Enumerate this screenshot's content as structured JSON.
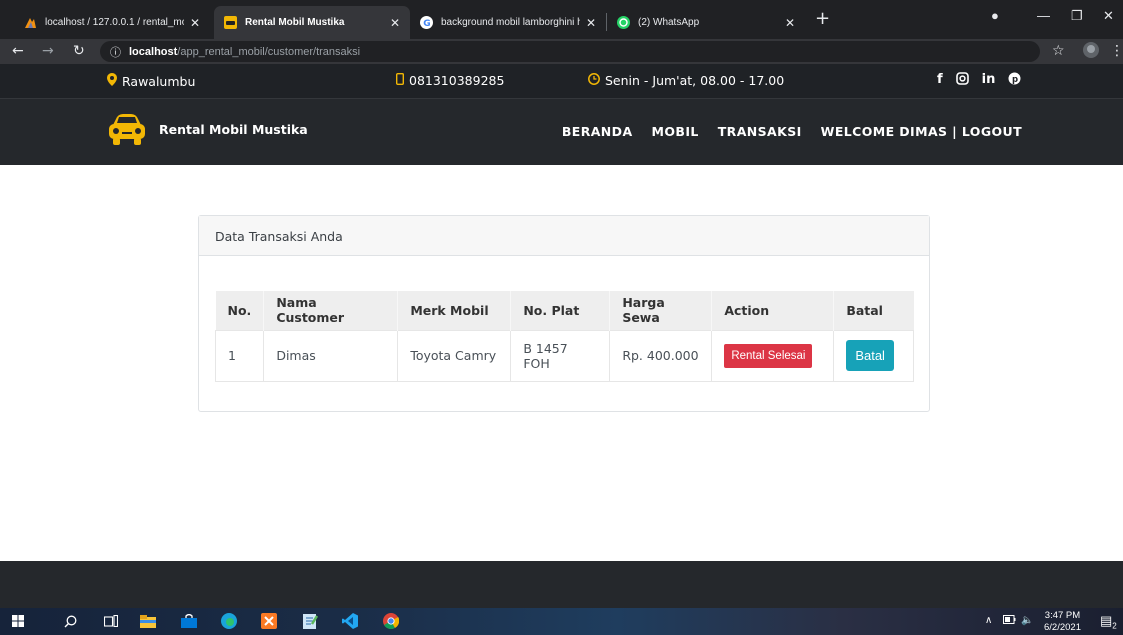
{
  "browser": {
    "tabs": [
      {
        "title": "localhost / 127.0.0.1 / rental_mob"
      },
      {
        "title": "Rental Mobil Mustika"
      },
      {
        "title": "background mobil lamborghini h"
      },
      {
        "title": "(2) WhatsApp"
      }
    ],
    "url_host": "localhost",
    "url_path": "/app_rental_mobil/customer/transaksi"
  },
  "topbar": {
    "location": "Rawalumbu",
    "phone": "081310389285",
    "hours": "Senin - Jum'at, 08.00 - 17.00",
    "social": [
      "f",
      "in"
    ]
  },
  "navbar": {
    "brand": "Rental Mobil Mustika",
    "menu": [
      "BERANDA",
      "MOBIL",
      "TRANSAKSI",
      "WELCOME DIMAS | LOGOUT"
    ]
  },
  "card": {
    "title": "Data Transaksi Anda",
    "columns": [
      "No.",
      "Nama Customer",
      "Merk Mobil",
      "No. Plat",
      "Harga Sewa",
      "Action",
      "Batal"
    ],
    "rows": [
      {
        "no": "1",
        "nama": "Dimas",
        "merk": "Toyota Camry",
        "plat": "B 1457 FOH",
        "harga": "Rp. 400.000",
        "action": "Rental Selesai",
        "batal": "Batal"
      }
    ]
  },
  "taskbar": {
    "time": "3:47 PM",
    "date": "6/2/2021",
    "notification_count": "2"
  },
  "colors": {
    "accent_yellow": "#f2b705",
    "danger": "#dc3545",
    "info": "#17a2b8",
    "navbar_bg": "#25282c"
  }
}
